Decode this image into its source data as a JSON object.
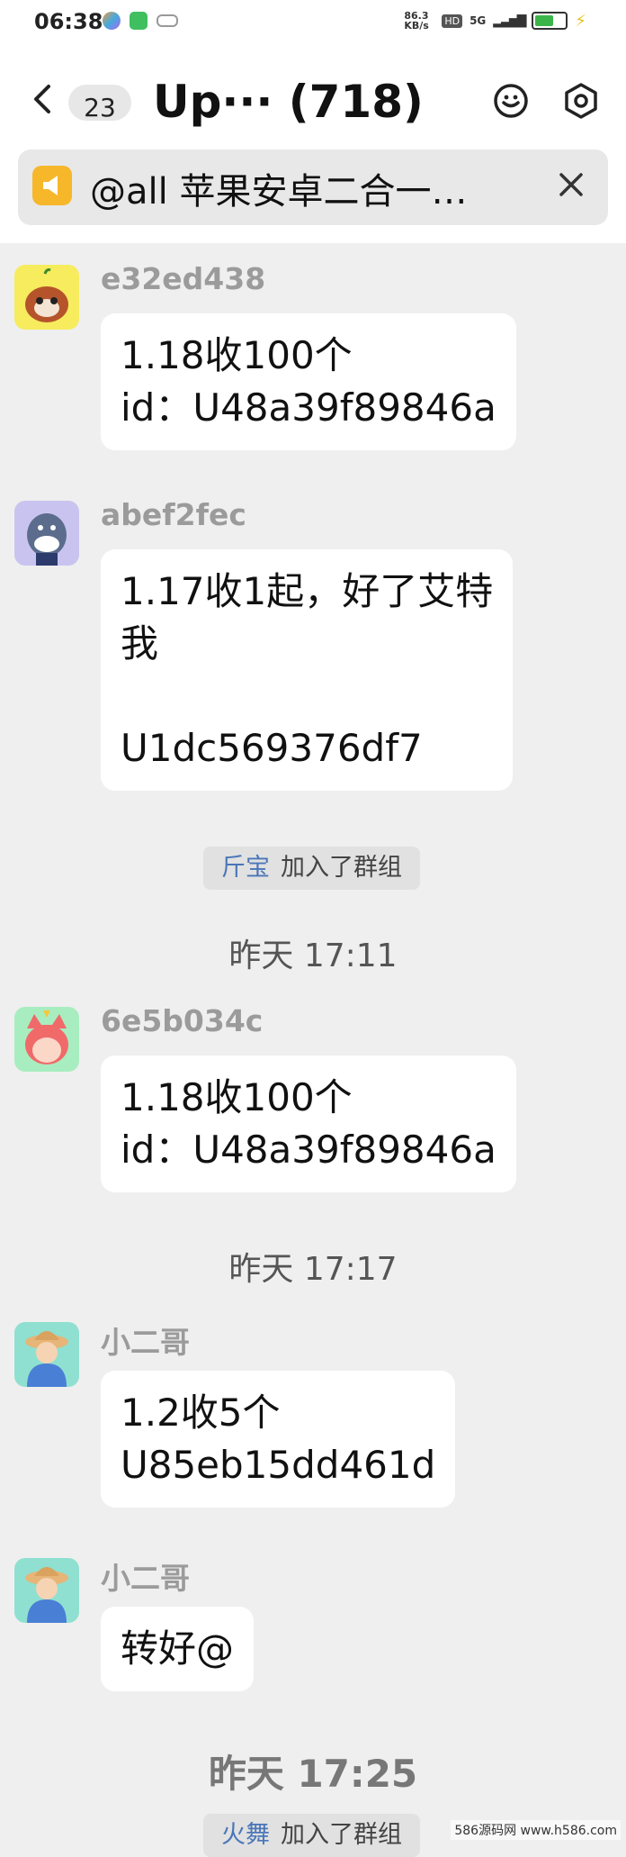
{
  "status": {
    "time": "06:38",
    "net_speed": "86.3 KB/s",
    "net_type": "5G"
  },
  "header": {
    "unread_badge": "23",
    "title": "Up··· (718)",
    "back_icon": "back-icon",
    "copilot_icon": "copilot-icon",
    "settings_icon": "settings-icon"
  },
  "notice": {
    "text": "@all 苹果安卓二合一…",
    "icon": "megaphone-icon",
    "close_icon": "close-icon"
  },
  "messages": [
    {
      "user": "e32ed438",
      "text": "1.18收100个\nid：U48a39f89846a",
      "avatar": "raccoon"
    },
    {
      "user": "abef2fec",
      "text": "1.17收1起，好了艾特\n我\n\nU1dc569376df7",
      "avatar": "shark"
    },
    {
      "user": "6e5b034c",
      "text": "1.18收100个\nid：U48a39f89846a",
      "avatar": "cat"
    },
    {
      "user": "小二哥",
      "text": "1.2收5个\nU85eb15dd461d",
      "avatar": "farmer"
    },
    {
      "user": "小二哥",
      "text": "转好@",
      "avatar": "farmer"
    }
  ],
  "system": [
    {
      "who": "斤宝",
      "action": "加入了群组"
    },
    {
      "who": "火舞",
      "action": "加入了群组"
    }
  ],
  "timestamps": [
    "昨天 17:11",
    "昨天 17:17",
    "昨天 17:25"
  ],
  "watermark": "586源码网 www.h586.com"
}
